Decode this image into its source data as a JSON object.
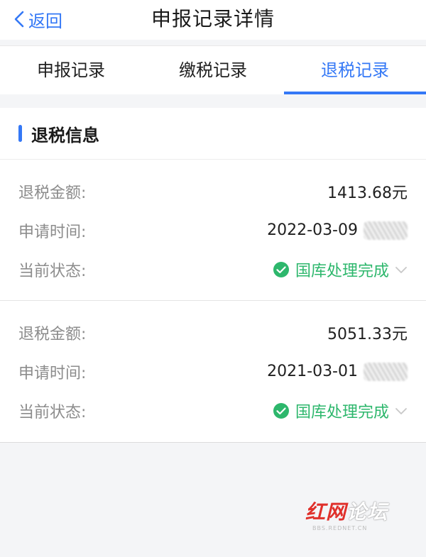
{
  "header": {
    "back_label": "返回",
    "title": "申报记录详情"
  },
  "tabs": [
    {
      "label": "申报记录",
      "active": false
    },
    {
      "label": "缴税记录",
      "active": false
    },
    {
      "label": "退税记录",
      "active": true
    }
  ],
  "section": {
    "title": "退税信息"
  },
  "records": [
    {
      "amount_label": "退税金额:",
      "amount": "1413.68元",
      "date_label": "申请时间:",
      "date": "2022-03-09",
      "status_label": "当前状态:",
      "status": "国库处理完成"
    },
    {
      "amount_label": "退税金额:",
      "amount": "5051.33元",
      "date_label": "申请时间:",
      "date": "2021-03-01",
      "status_label": "当前状态:",
      "status": "国库处理完成"
    }
  ],
  "watermark": {
    "part1": "红网",
    "part2": "论坛",
    "sub": "BBS.REDNET.CN"
  },
  "colors": {
    "accent": "#3478f6",
    "success": "#2db76c",
    "label_gray": "#8c8c8c",
    "background": "#f4f5f7"
  },
  "icons": {
    "back": "chevron-left-icon",
    "status": "check-circle-icon",
    "expand": "chevron-down-icon"
  }
}
